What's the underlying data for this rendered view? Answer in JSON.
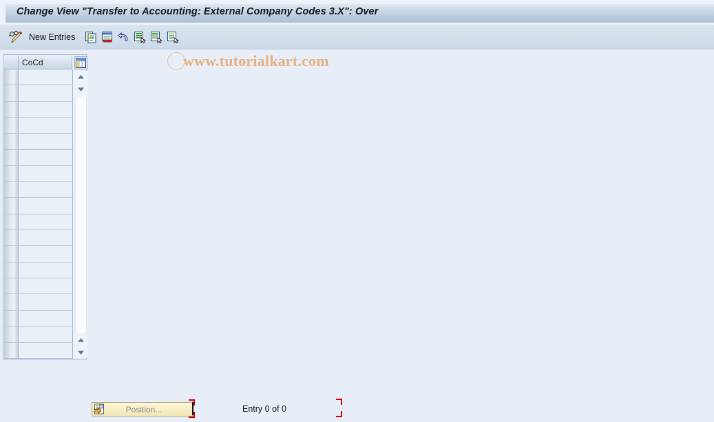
{
  "window": {
    "title": "Change View \"Transfer to Accounting: External Company Codes 3.X\": Over"
  },
  "toolbar": {
    "display_change_icon": "pencil-glasses-icon",
    "new_entries_label": "New Entries",
    "buttons": [
      {
        "name": "copy-as-icon",
        "label": ""
      },
      {
        "name": "delete-icon",
        "label": ""
      },
      {
        "name": "undo-icon",
        "label": ""
      },
      {
        "name": "select-all-icon",
        "label": ""
      },
      {
        "name": "deselect-all-icon",
        "label": ""
      },
      {
        "name": "details-icon",
        "label": ""
      }
    ]
  },
  "watermark": {
    "text": "www.tutorialkart.com",
    "color": "#e8b182"
  },
  "table": {
    "columns": [
      {
        "name": "select-column",
        "label": ""
      },
      {
        "name": "cocd-column",
        "label": "CoCd"
      }
    ],
    "config_icon": "column-config-icon",
    "row_count": 18,
    "rows": []
  },
  "scrollbar": {
    "up_icon": "triangle-up-icon",
    "down_icon": "triangle-down-icon"
  },
  "footer": {
    "position_button_label": "Position...",
    "position_button_icon": "position-icon",
    "entry_status": "Entry 0 of 0",
    "selection_marker_color": "#d00000"
  },
  "colors": {
    "background": "#e8eef7",
    "title_gradient_top": "#dee7f2",
    "title_gradient_bottom": "#b0c2d9",
    "toolbar": "#d3dfec",
    "table_border": "#9fb4cc",
    "cell_bg": "#eaf0f8"
  }
}
